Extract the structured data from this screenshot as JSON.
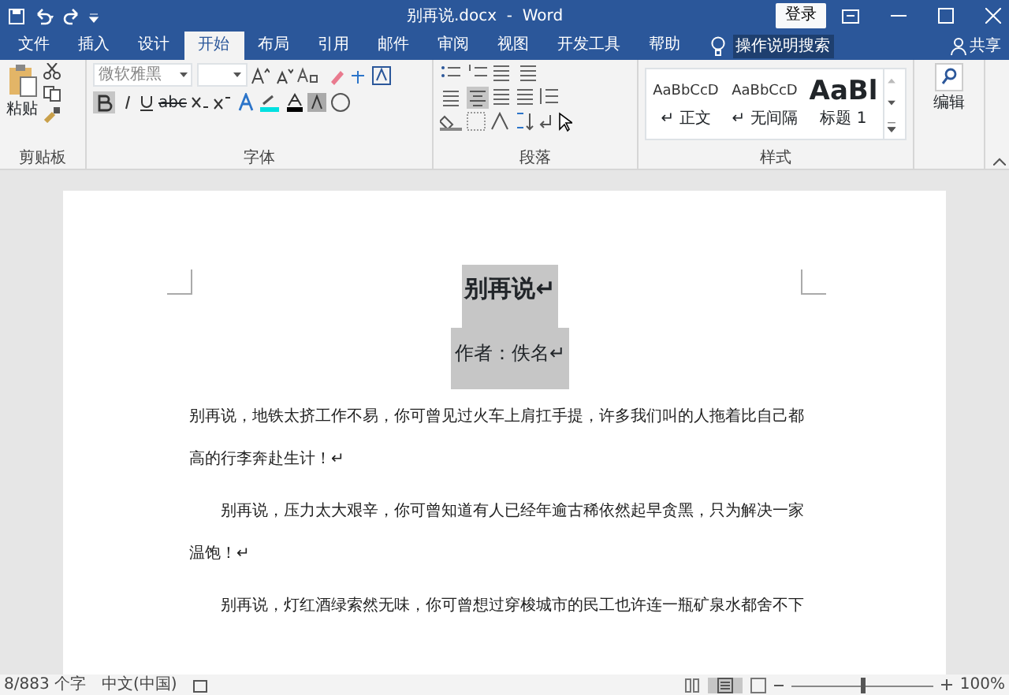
{
  "title_bar": {
    "title": "别再说.docx  -  Word",
    "login": "登录"
  },
  "tabs": [
    {
      "label": "文件",
      "selected": false
    },
    {
      "label": "插入",
      "selected": false
    },
    {
      "label": "设计",
      "selected": false
    },
    {
      "label": "开始",
      "selected": true
    },
    {
      "label": "布局",
      "selected": false
    },
    {
      "label": "引用",
      "selected": false
    },
    {
      "label": "邮件",
      "selected": false
    },
    {
      "label": "审阅",
      "selected": false
    },
    {
      "label": "视图",
      "selected": false
    },
    {
      "label": "开发工具",
      "selected": false
    },
    {
      "label": "帮助",
      "selected": false
    }
  ],
  "tell_me": "操作说明搜索",
  "share": "共享",
  "ribbon": {
    "clipboard": {
      "paste": "粘贴",
      "label": "剪贴板"
    },
    "font": {
      "name": "微软雅黑",
      "label": "字体",
      "bold_on": true,
      "abc": "abc"
    },
    "paragraph": {
      "label": "段落",
      "center_on": true
    },
    "styles": {
      "label": "样式",
      "items": [
        {
          "preview": "AaBbCcD",
          "name": "↵ 正文",
          "kind": "small"
        },
        {
          "preview": "AaBbCcD",
          "name": "↵ 无间隔",
          "kind": "small"
        },
        {
          "preview": "AaBl",
          "name": "标题 1",
          "kind": "big"
        }
      ]
    },
    "editing": "编辑"
  },
  "document": {
    "title": "别再说↵",
    "author": "作者：佚名↵",
    "paragraphs": [
      "别再说，地铁太挤工作不易，你可曾见过火车上肩扛手提，许多我们叫的人拖着比自己都高的行李奔赴生计！↵",
      "别再说，压力太大艰辛，你可曾知道有人已经年逾古稀依然起早贪黑，只为解决一家温饱！↵",
      "别再说，灯红酒绿索然无味，你可曾想过穿梭城市的民工也许连一瓶矿泉水都舍不下"
    ]
  },
  "status_bar": {
    "words": "8/883 个字",
    "language": "中文(中国)",
    "zoom": "100%",
    "level": 0.5
  }
}
